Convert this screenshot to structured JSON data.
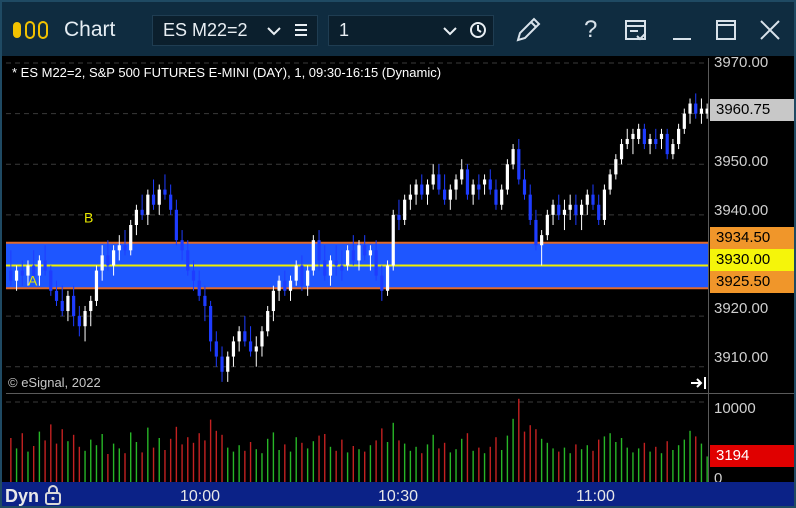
{
  "window": {
    "title": "Chart",
    "symbol_dropdown": "ES M22=2",
    "interval_dropdown": "1",
    "icons": [
      "app-logo-icon",
      "chevron-down-icon",
      "menu-lines-icon",
      "chevron-down-icon",
      "clock-icon",
      "pencil-icon",
      "help-icon",
      "window-list-icon",
      "minimize-icon",
      "maximize-icon",
      "close-icon"
    ],
    "help_glyph": "?"
  },
  "chart": {
    "description": "* ES M22=2, S&P 500 FUTURES E-MINI (DAY), 1, 09:30-16:15 (Dynamic)",
    "copyright": "© eSignal, 2022",
    "annotations": {
      "a": "A",
      "b": "B"
    },
    "price_axis": [
      "3970.00",
      "3960.75",
      "3950.00",
      "3940.00",
      "3934.50",
      "3930.00",
      "3925.50",
      "3920.00",
      "3910.00"
    ],
    "volume_axis": [
      "10000",
      "3194",
      "0"
    ],
    "time_axis": [
      "10:00",
      "10:30",
      "11:00"
    ],
    "colors": {
      "up": "#ffffff",
      "down": "#1e3cff",
      "band": "#1e56ff",
      "band_edge": "#e06a2c",
      "mid_line": "#f0f000",
      "vol_up": "#27b627",
      "vol_down": "#c42121",
      "last_price_bg": "#c8c8c8",
      "box_high_bg": "#f0962a",
      "box_mid_bg": "#f5f50a",
      "box_low_bg": "#f0962a",
      "vol_last_bg": "#e00000"
    }
  },
  "chart_data": {
    "type": "candlestick",
    "y_range": [
      3905,
      3971
    ],
    "volume_range": [
      0,
      11000
    ],
    "last_price": 3960.75,
    "last_volume": 3194,
    "range_box": {
      "high": 3934.5,
      "mid": 3930.0,
      "low": 3925.5
    },
    "markers": [
      {
        "label": "A",
        "price": 3927
      },
      {
        "label": "B",
        "price": 3938
      }
    ],
    "bars": [
      [
        3929,
        3933,
        3926,
        3927,
        5500
      ],
      [
        3927,
        3930,
        3925,
        3929,
        4200
      ],
      [
        3929,
        3931,
        3926,
        3928,
        6100
      ],
      [
        3928,
        3931,
        3926,
        3930,
        3800
      ],
      [
        3930,
        3933,
        3927,
        3928,
        4500
      ],
      [
        3928,
        3932,
        3926,
        3931,
        6300
      ],
      [
        3931,
        3934,
        3928,
        3929,
        5200
      ],
      [
        3929,
        3930,
        3924,
        3925,
        7200
      ],
      [
        3925,
        3927,
        3922,
        3923,
        4800
      ],
      [
        3923,
        3926,
        3920,
        3921,
        6600
      ],
      [
        3921,
        3925,
        3919,
        3924,
        5100
      ],
      [
        3924,
        3926,
        3918,
        3920,
        5900
      ],
      [
        3920,
        3922,
        3916,
        3918,
        4400
      ],
      [
        3918,
        3922,
        3915,
        3921,
        3900
      ],
      [
        3921,
        3924,
        3918,
        3923,
        5300
      ],
      [
        3923,
        3930,
        3922,
        3929,
        4600
      ],
      [
        3929,
        3934,
        3927,
        3932,
        6000
      ],
      [
        3932,
        3935,
        3929,
        3930,
        3500
      ],
      [
        3930,
        3934,
        3928,
        3933,
        4800
      ],
      [
        3933,
        3936,
        3931,
        3934,
        4200
      ],
      [
        3934,
        3937,
        3932,
        3933,
        3600
      ],
      [
        3933,
        3939,
        3932,
        3938,
        6200
      ],
      [
        3938,
        3942,
        3936,
        3941,
        5000
      ],
      [
        3941,
        3944,
        3939,
        3940,
        3700
      ],
      [
        3940,
        3945,
        3938,
        3944,
        6800
      ],
      [
        3944,
        3947,
        3941,
        3942,
        4300
      ],
      [
        3942,
        3946,
        3940,
        3945,
        5500
      ],
      [
        3945,
        3948,
        3943,
        3944,
        4000
      ],
      [
        3944,
        3946,
        3940,
        3941,
        5400
      ],
      [
        3941,
        3943,
        3934,
        3935,
        6900
      ],
      [
        3935,
        3937,
        3931,
        3933,
        4700
      ],
      [
        3933,
        3935,
        3928,
        3929,
        5600
      ],
      [
        3929,
        3931,
        3925,
        3927,
        4900
      ],
      [
        3927,
        3929,
        3923,
        3924,
        6100
      ],
      [
        3924,
        3926,
        3919,
        3922,
        5200
      ],
      [
        3922,
        3923,
        3913,
        3915,
        7800
      ],
      [
        3915,
        3917,
        3910,
        3912,
        6400
      ],
      [
        3912,
        3914,
        3907,
        3909,
        5900
      ],
      [
        3909,
        3913,
        3907,
        3912,
        4300
      ],
      [
        3912,
        3916,
        3910,
        3915,
        3800
      ],
      [
        3915,
        3918,
        3913,
        3917,
        4600
      ],
      [
        3917,
        3920,
        3914,
        3915,
        3900
      ],
      [
        3915,
        3918,
        3912,
        3913,
        5000
      ],
      [
        3913,
        3916,
        3910,
        3914,
        4100
      ],
      [
        3914,
        3918,
        3912,
        3917,
        3600
      ],
      [
        3917,
        3922,
        3916,
        3921,
        5400
      ],
      [
        3921,
        3926,
        3919,
        3925,
        6200
      ],
      [
        3925,
        3928,
        3923,
        3927,
        4000
      ],
      [
        3927,
        3929,
        3924,
        3925,
        4700
      ],
      [
        3925,
        3928,
        3923,
        3927,
        3800
      ],
      [
        3927,
        3931,
        3926,
        3930,
        5600
      ],
      [
        3930,
        3932,
        3925,
        3926,
        4900
      ],
      [
        3926,
        3930,
        3924,
        3929,
        4200
      ],
      [
        3929,
        3936,
        3928,
        3935,
        5100
      ],
      [
        3935,
        3937,
        3929,
        3931,
        5800
      ],
      [
        3931,
        3934,
        3927,
        3928,
        6000
      ],
      [
        3928,
        3932,
        3926,
        3931,
        4400
      ],
      [
        3931,
        3934,
        3928,
        3930,
        3900
      ],
      [
        3930,
        3933,
        3927,
        3929,
        5300
      ],
      [
        3930,
        3934,
        3929,
        3933,
        3700
      ],
      [
        3933,
        3936,
        3930,
        3931,
        4500
      ],
      [
        3931,
        3935,
        3929,
        3934,
        4100
      ],
      [
        3934,
        3936,
        3931,
        3932,
        3800
      ],
      [
        3932,
        3934,
        3929,
        3933,
        4600
      ],
      [
        3933,
        3935,
        3927,
        3928,
        5200
      ],
      [
        3928,
        3930,
        3923,
        3925,
        6700
      ],
      [
        3925,
        3931,
        3924,
        3930,
        5000
      ],
      [
        3930,
        3941,
        3929,
        3940,
        7400
      ],
      [
        3940,
        3943,
        3937,
        3939,
        5200
      ],
      [
        3939,
        3944,
        3938,
        3943,
        4800
      ],
      [
        3943,
        3946,
        3941,
        3944,
        3900
      ],
      [
        3944,
        3947,
        3942,
        3946,
        4400
      ],
      [
        3946,
        3948,
        3943,
        3944,
        3600
      ],
      [
        3944,
        3947,
        3942,
        3946,
        4700
      ],
      [
        3946,
        3950,
        3945,
        3948,
        5900
      ],
      [
        3948,
        3950,
        3944,
        3945,
        4200
      ],
      [
        3945,
        3948,
        3942,
        3943,
        4900
      ],
      [
        3943,
        3946,
        3941,
        3945,
        3700
      ],
      [
        3945,
        3948,
        3943,
        3947,
        4100
      ],
      [
        3947,
        3951,
        3946,
        3949,
        5400
      ],
      [
        3949,
        3950,
        3943,
        3944,
        6100
      ],
      [
        3944,
        3947,
        3942,
        3946,
        3900
      ],
      [
        3946,
        3948,
        3943,
        3945,
        4300
      ],
      [
        3946,
        3948,
        3944,
        3947,
        3600
      ],
      [
        3947,
        3949,
        3944,
        3945,
        4400
      ],
      [
        3945,
        3947,
        3941,
        3942,
        5600
      ],
      [
        3942,
        3946,
        3941,
        3945,
        4000
      ],
      [
        3945,
        3951,
        3944,
        3950,
        5800
      ],
      [
        3950,
        3954,
        3949,
        3953,
        7900
      ],
      [
        3953,
        3955,
        3946,
        3947,
        10400
      ],
      [
        3947,
        3949,
        3943,
        3944,
        6300
      ],
      [
        3944,
        3946,
        3938,
        3939,
        7100
      ],
      [
        3939,
        3941,
        3933,
        3934,
        6600
      ],
      [
        3934,
        3937,
        3930,
        3936,
        5400
      ],
      [
        3936,
        3941,
        3935,
        3940,
        4900
      ],
      [
        3940,
        3943,
        3938,
        3942,
        4200
      ],
      [
        3942,
        3944,
        3939,
        3940,
        3800
      ],
      [
        3940,
        3943,
        3937,
        3941,
        4300
      ],
      [
        3941,
        3944,
        3939,
        3942,
        3600
      ],
      [
        3942,
        3944,
        3938,
        3940,
        4700
      ],
      [
        3940,
        3943,
        3937,
        3942,
        4100
      ],
      [
        3942,
        3945,
        3940,
        3944,
        4600
      ],
      [
        3944,
        3946,
        3941,
        3942,
        3900
      ],
      [
        3942,
        3944,
        3938,
        3939,
        5300
      ],
      [
        3939,
        3946,
        3938,
        3945,
        5700
      ],
      [
        3945,
        3949,
        3944,
        3948,
        6100
      ],
      [
        3948,
        3952,
        3947,
        3951,
        5000
      ],
      [
        3951,
        3955,
        3950,
        3954,
        5500
      ],
      [
        3954,
        3957,
        3953,
        3955,
        4300
      ],
      [
        3955,
        3957,
        3952,
        3956,
        3700
      ],
      [
        3955,
        3958,
        3954,
        3957,
        4200
      ],
      [
        3957,
        3958,
        3953,
        3954,
        4900
      ],
      [
        3954,
        3956,
        3952,
        3955,
        3800
      ],
      [
        3955,
        3957,
        3953,
        3954,
        4400
      ],
      [
        3955,
        3957,
        3953,
        3956,
        3600
      ],
      [
        3956,
        3957,
        3951,
        3952,
        5100
      ],
      [
        3952,
        3955,
        3951,
        3954,
        4000
      ],
      [
        3954,
        3958,
        3953,
        3957,
        4600
      ],
      [
        3957,
        3961,
        3956,
        3960,
        5300
      ],
      [
        3960,
        3963,
        3958,
        3962,
        6400
      ],
      [
        3962,
        3964,
        3959,
        3960,
        5700
      ],
      [
        3960,
        3963,
        3958,
        3961,
        4800
      ],
      [
        3960,
        3962,
        3959,
        3961,
        3194
      ]
    ]
  }
}
